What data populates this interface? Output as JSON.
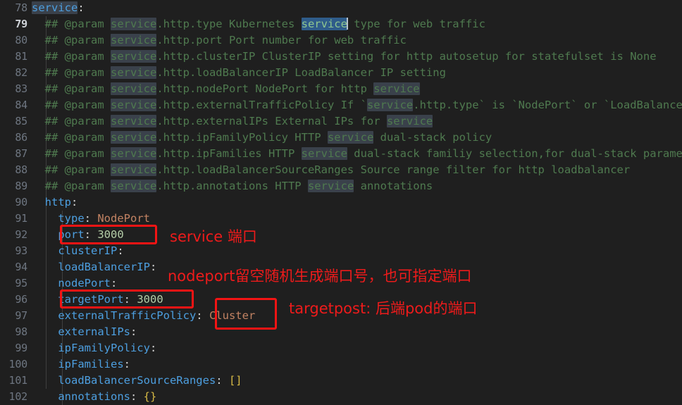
{
  "editor": {
    "theme": "dark",
    "language": "yaml",
    "background_color": "#1f1f1f",
    "active_line": 79,
    "first_line": 78,
    "last_line": 102,
    "colors": {
      "comment": "#4f7a4f",
      "key": "#4d9fe0",
      "string": "#c38363",
      "number": "#b5cea8",
      "bracket": "#d7ba45",
      "line_number": "#6e7681",
      "active_line_number": "#cfd3d8",
      "occurrence_highlight": "#3a414b",
      "selection": "#2f5c8a",
      "annotation_red": "#ee1b1b"
    }
  },
  "line_numbers": [
    "78",
    "79",
    "80",
    "81",
    "82",
    "83",
    "84",
    "85",
    "86",
    "87",
    "88",
    "89",
    "90",
    "91",
    "92",
    "93",
    "94",
    "95",
    "96",
    "97",
    "98",
    "99",
    "100",
    "101",
    "102"
  ],
  "lines": [
    {
      "n": "78",
      "text": "service:"
    },
    {
      "n": "79",
      "text": "  ## @param service.http.type Kubernetes service type for web traffic"
    },
    {
      "n": "80",
      "text": "  ## @param service.http.port Port number for web traffic"
    },
    {
      "n": "81",
      "text": "  ## @param service.http.clusterIP ClusterIP setting for http autosetup for statefulset is None"
    },
    {
      "n": "82",
      "text": "  ## @param service.http.loadBalancerIP LoadBalancer IP setting"
    },
    {
      "n": "83",
      "text": "  ## @param service.http.nodePort NodePort for http service"
    },
    {
      "n": "84",
      "text": "  ## @param service.http.externalTrafficPolicy If `service.http.type` is `NodePort` or `LoadBalancer`"
    },
    {
      "n": "85",
      "text": "  ## @param service.http.externalIPs External IPs for service"
    },
    {
      "n": "86",
      "text": "  ## @param service.http.ipFamilyPolicy HTTP service dual-stack policy"
    },
    {
      "n": "87",
      "text": "  ## @param service.http.ipFamilies HTTP service dual-stack familiy selection,for dual-stack parameters"
    },
    {
      "n": "88",
      "text": "  ## @param service.http.loadBalancerSourceRanges Source range filter for http loadbalancer"
    },
    {
      "n": "89",
      "text": "  ## @param service.http.annotations HTTP service annotations"
    },
    {
      "n": "90",
      "text": "  http:"
    },
    {
      "n": "91",
      "text": "    type: NodePort"
    },
    {
      "n": "92",
      "text": "    port: 3000"
    },
    {
      "n": "93",
      "text": "    clusterIP:"
    },
    {
      "n": "94",
      "text": "    loadBalancerIP:"
    },
    {
      "n": "95",
      "text": "    nodePort:"
    },
    {
      "n": "96",
      "text": "    targetPort: 3000"
    },
    {
      "n": "97",
      "text": "    externalTrafficPolicy: Cluster"
    },
    {
      "n": "98",
      "text": "    externalIPs:"
    },
    {
      "n": "99",
      "text": "    ipFamilyPolicy:"
    },
    {
      "n": "100",
      "text": "    ipFamilies:"
    },
    {
      "n": "101",
      "text": "    loadBalancerSourceRanges: []"
    },
    {
      "n": "102",
      "text": "    annotations: {}"
    }
  ],
  "selection": {
    "line": 79,
    "text": "service",
    "caret_visible": true
  },
  "annotations": {
    "boxes": [
      {
        "name": "port-box",
        "target": "port: 3000"
      },
      {
        "name": "target-port-box",
        "target": "targetPort: 3000"
      },
      {
        "name": "cluster-box",
        "target": "Cluster"
      }
    ],
    "notes": [
      {
        "name": "service-port-note",
        "text": "service 端口"
      },
      {
        "name": "nodeport-note",
        "text": "nodeport留空随机生成端口号，也可指定端口"
      },
      {
        "name": "targetport-note",
        "text": "targetpost: 后端pod的端口"
      }
    ]
  }
}
